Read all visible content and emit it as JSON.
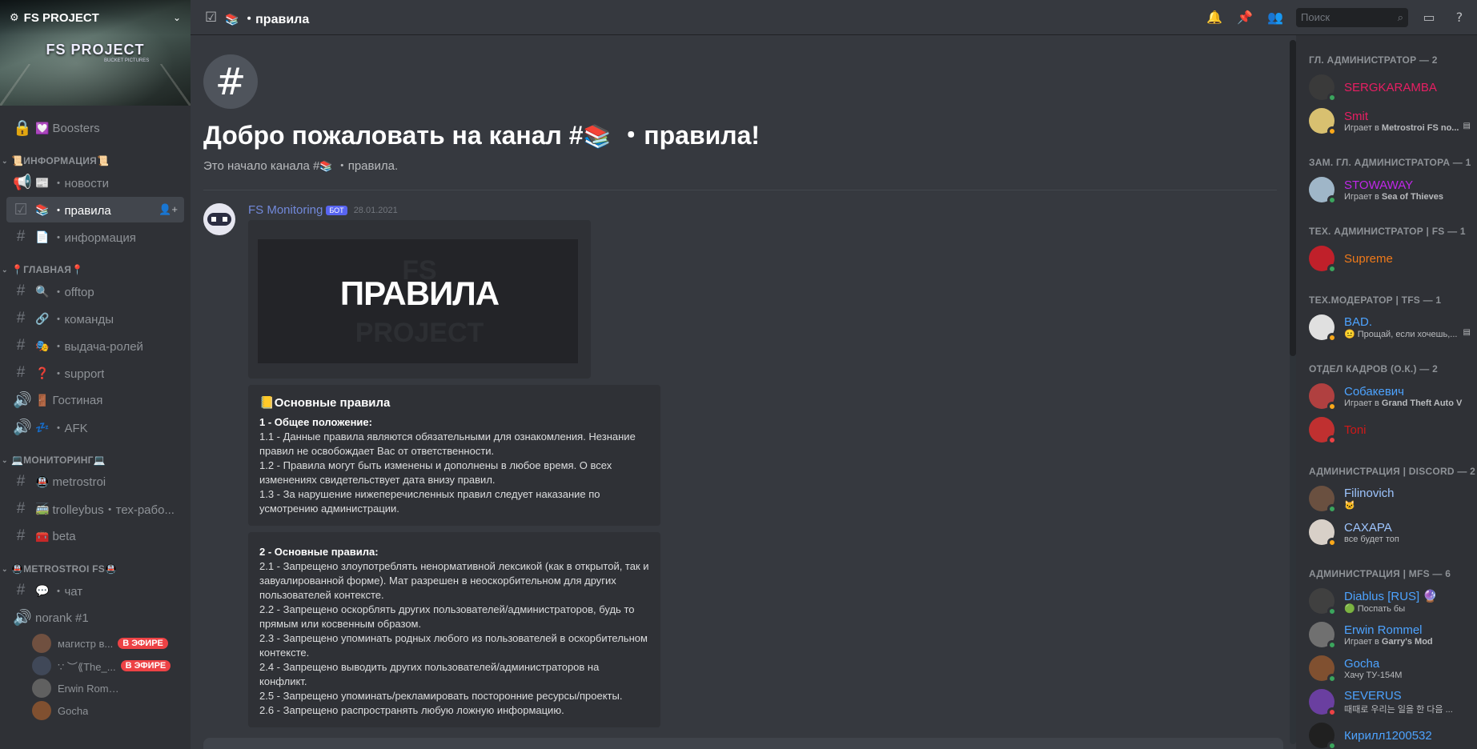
{
  "server": {
    "name": "FS PROJECT",
    "banner_logo": "FS PROJECT",
    "banner_sub": "BUCKET PICTURES"
  },
  "sidebar": {
    "boosters": "Boosters",
    "categories": [
      {
        "label": "📜ИНФОРМАЦИЯ📜",
        "channels": [
          {
            "icon": "megaphone",
            "emoji": "📰",
            "label": "・новости"
          },
          {
            "icon": "rules",
            "emoji": "📚",
            "label": "・правила",
            "active": true
          },
          {
            "icon": "hash",
            "emoji": "📄",
            "label": "・информация"
          }
        ]
      },
      {
        "label": "📍ГЛАВНАЯ📍",
        "channels": [
          {
            "icon": "hash",
            "emoji": "🔍",
            "label": "・offtop"
          },
          {
            "icon": "hash",
            "emoji": "🔗",
            "label": "・команды"
          },
          {
            "icon": "hash",
            "emoji": "🎭",
            "label": "・выдача-ролей"
          },
          {
            "icon": "hash",
            "emoji": "❓",
            "label": "・support"
          },
          {
            "icon": "speaker",
            "emoji": "🚪",
            "label": "Гостиная"
          },
          {
            "icon": "speaker",
            "emoji": "💤",
            "label": "・AFK"
          }
        ]
      },
      {
        "label": "💻МОНИТОРИНГ💻",
        "channels": [
          {
            "icon": "hash",
            "emoji": "🚇",
            "label": "metrostroi"
          },
          {
            "icon": "hash",
            "emoji": "🚎",
            "label": "trolleybus・тех-рабо..."
          },
          {
            "icon": "hash",
            "emoji": "🧰",
            "label": "beta"
          }
        ]
      },
      {
        "label": "🚇METROSTROI FS🚇",
        "channels": [
          {
            "icon": "hash",
            "emoji": "💬",
            "label": "・чат"
          },
          {
            "icon": "speaker",
            "emoji": "",
            "label": "norank #1"
          }
        ]
      }
    ],
    "voice_users": [
      {
        "name": "магистр в...",
        "live": "В ЭФИРЕ"
      },
      {
        "name": "∵ ︶⟪The_...",
        "live": "В ЭФИРЕ"
      },
      {
        "name": "Erwin Rommel",
        "live": ""
      },
      {
        "name": "Gocha",
        "live": ""
      }
    ]
  },
  "topbar": {
    "channel": "・правила",
    "search_placeholder": "Поиск"
  },
  "chat": {
    "welcome_title_prefix": "Добро пожаловать на канал #",
    "welcome_title_suffix": " ・правила!",
    "welcome_sub_prefix": "Это начало канала #",
    "welcome_sub_suffix": " ・правила.",
    "message": {
      "author": "FS Monitoring",
      "badge": "БОТ",
      "timestamp": "28.01.2021",
      "image_text": "ПРАВИЛА",
      "image_bg1": "FS",
      "image_bg2": "PROJECT"
    },
    "embed1": {
      "title": "Основные правила",
      "section": "1 - Общее положение:",
      "lines": [
        "1.1 - Данные правила являются обязательными для ознакомления. Незнание правил не освобождает Вас от ответственности.",
        "1.2 - Правила могут быть изменены и дополнены в любое время. О всех изменениях свидетельствует дата внизу правил.",
        "1.3 - За нарушение нижеперечисленных правил следует наказание по усмотрению администрации."
      ]
    },
    "embed2": {
      "section": "2 - Основные правила:",
      "lines": [
        "2.1 - Запрещено злоупотреблять ненормативной лексикой (как в открытой, так и завуалированной форме). Мат разрешен в неоскорбительном для других пользователей контексте.",
        "2.2 - Запрещено оскорблять других пользователей/администраторов, будь то прямым или косвенным образом.",
        "2.3 - Запрещено упоминать родных любого из пользователей в оскорбительном контексте.",
        "2.4 - Запрещено выводить других пользователей/администраторов на конфликт.",
        "2.5 - Запрещено упоминать/рекламировать посторонние ресурсы/проекты.",
        "2.6 - Запрещено распространять любую ложную информацию."
      ]
    }
  },
  "members": [
    {
      "group": "ГЛ. АДМИНИСТРАТОР — 2",
      "items": [
        {
          "name": "SERGKARAMBA",
          "color": "#e91e63",
          "activity": "",
          "status": "online",
          "av": "#3a3a3a"
        },
        {
          "name": "Smit",
          "color": "#e91e63",
          "activity_prefix": "Играет в ",
          "activity_bold": "Metrostroi FS no...",
          "status": "idle",
          "av": "#d8c070",
          "doc": true
        }
      ]
    },
    {
      "group": "ЗАМ. ГЛ. АДМИНИСТРАТОРА — 1",
      "items": [
        {
          "name": "STOWAWAY",
          "color": "#c027e9",
          "activity_prefix": "Играет в ",
          "activity_bold": "Sea of Thieves",
          "status": "online",
          "av": "#9fb6c8"
        }
      ]
    },
    {
      "group": "ТЕХ. АДМИНИСТРАТОР | FS — 1",
      "items": [
        {
          "name": "Supreme",
          "color": "#f07a1a",
          "activity": "",
          "status": "online",
          "av": "#c0202a"
        }
      ]
    },
    {
      "group": "ТЕХ.МОДЕРАТОР | TFS — 1",
      "items": [
        {
          "name": "BAD.",
          "color": "#4da3ff",
          "activity": "😐 Прощай, если хочешь,...",
          "status": "idle",
          "av": "#e0e0e0",
          "doc": true
        }
      ]
    },
    {
      "group": "ОТДЕЛ КАДРОВ (О.К.) — 2",
      "items": [
        {
          "name": "Собакевич",
          "color": "#4da3ff",
          "activity_prefix": "Играет в ",
          "activity_bold": "Grand Theft Auto V",
          "status": "idle",
          "av": "#b04040"
        },
        {
          "name": "Toni",
          "color": "#d01818",
          "activity": "",
          "status": "dnd",
          "av": "#c03030"
        }
      ]
    },
    {
      "group": "АДМИНИСТРАЦИЯ | DISCORD — 2",
      "items": [
        {
          "name": "Filinovich",
          "color": "#9ec5ff",
          "activity": "🐱",
          "status": "online",
          "av": "#6a5040"
        },
        {
          "name": "CAXAPA",
          "color": "#9ec5ff",
          "activity": "все будет топ",
          "status": "idle",
          "av": "#d8d0c8"
        }
      ]
    },
    {
      "group": "АДМИНИСТРАЦИЯ | MFS — 6",
      "items": [
        {
          "name": "Diablus [RUS] 🔮",
          "color": "#4da3ff",
          "activity": "🟢 Поспать бы",
          "status": "online",
          "av": "#404040"
        },
        {
          "name": "Erwin Rommel",
          "color": "#4da3ff",
          "activity_prefix": "Играет в ",
          "activity_bold": "Garry's Mod",
          "status": "online",
          "av": "#707070"
        },
        {
          "name": "Gocha",
          "color": "#4da3ff",
          "activity": "Хачу ТУ-154М",
          "status": "online",
          "av": "#805030"
        },
        {
          "name": "SEVERUS",
          "color": "#4da3ff",
          "activity": "때때로 우리는 일을 한 다음 ...",
          "status": "dnd",
          "av": "#6a3fa0"
        },
        {
          "name": "Кирилл1200532",
          "color": "#4da3ff",
          "activity": "",
          "status": "online",
          "av": "#202020"
        }
      ]
    }
  ]
}
